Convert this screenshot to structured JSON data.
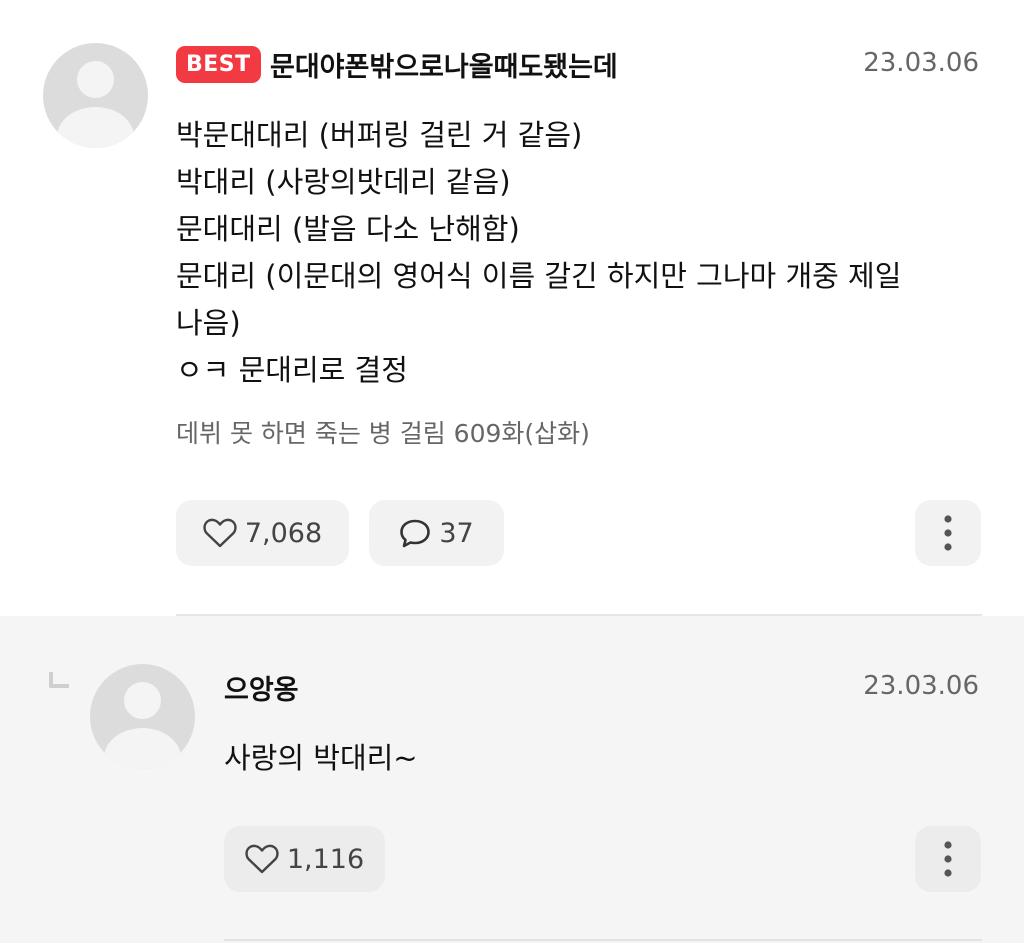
{
  "comment": {
    "badge": "BEST",
    "author": "문대야폰밖으로나올때도됐는데",
    "date": "23.03.06",
    "body_lines": [
      "박문대대리 (버퍼링 걸린 거 같음)",
      "박대리 (사랑의밧데리 같음)",
      "문대대리 (발음 다소 난해함)",
      "문대리 (이문대의 영어식 이름 갈긴 하지만 그나마 개중 제일",
      "나음)",
      "ㅇㅋ 문대리로 결정"
    ],
    "episode": "데뷔 못 하면 죽는 병 걸림 609화(삽화)",
    "likes": "7,068",
    "replies": "37",
    "icons": {
      "avatar": "default-avatar-icon",
      "like": "heart-outline-icon",
      "reply": "speech-bubble-icon",
      "more": "more-vertical-icon"
    }
  },
  "reply": {
    "author": "으앙옹",
    "date": "23.03.06",
    "body": "사랑의 박대리~",
    "likes": "1,116",
    "icons": {
      "indent": "reply-indent-icon",
      "avatar": "default-avatar-icon",
      "like": "heart-outline-icon",
      "more": "more-vertical-icon"
    }
  },
  "colors": {
    "badge_bg": "#f23a43",
    "text_primary": "#111111",
    "text_secondary": "#666666",
    "button_bg": "#f2f2f2",
    "reply_bg": "#f5f5f5"
  }
}
